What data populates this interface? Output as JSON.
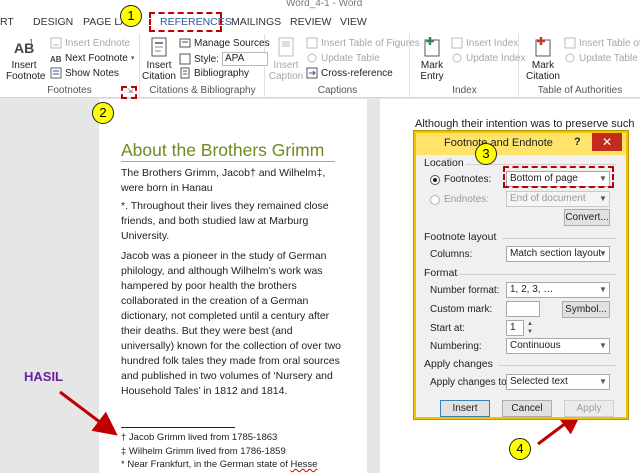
{
  "window": {
    "title": "Word_4-1 - Word"
  },
  "tabs": [
    "RT",
    "DESIGN",
    "PAGE LA",
    "REFERENCES",
    "MAILINGS",
    "REVIEW",
    "VIEW"
  ],
  "ribbon": {
    "footnotes": {
      "label": "Footnotes",
      "insert_footnote": "Insert Footnote",
      "insert_endnote": "Insert Endnote",
      "next_footnote": "Next Footnote",
      "show_notes": "Show Notes"
    },
    "citations": {
      "label": "Citations & Bibliography",
      "insert_citation": "Insert Citation",
      "manage_sources": "Manage Sources",
      "style_label": "Style:",
      "style_value": "APA",
      "bibliography": "Bibliography"
    },
    "captions": {
      "label": "Captions",
      "insert_caption": "Insert Caption",
      "insert_table_of_figures": "Insert Table of Figures",
      "update_table": "Update Table",
      "cross_reference": "Cross-reference"
    },
    "index": {
      "label": "Index",
      "mark_entry": "Mark Entry",
      "insert_index": "Insert Index",
      "update_index": "Update Index"
    },
    "authorities": {
      "label": "Table of Authorities",
      "mark_citation": "Mark Citation",
      "insert_table_of_authorities": "Insert Table of A",
      "update_table": "Update Table"
    }
  },
  "document": {
    "title": "About the Brothers Grimm",
    "p1": "The Brothers Grimm, Jacob† and Wilhelm‡, were born in Hanau",
    "p2": "*. Throughout their lives they remained close friends, and both studied law at Marburg University.",
    "p3": "Jacob was a pioneer in the study of German philology, and although Wilhelm’s work was hampered by poor health the brothers collaborated in the creation of a German dictionary, not completed until a century after their deaths. But they were best (and universally) known for the collection of over two hundred folk tales they made from oral sources and published in two volumes of ‘Nursery and Household Tales’ in 1812 and 1814.",
    "footnotes": [
      {
        "mark": "†",
        "text": " Jacob Grimm lived from 1785-1863"
      },
      {
        "mark": "‡",
        "text": " Wilhelm Grimm lived from 1786-1859"
      },
      {
        "mark": "*",
        "text": " Near Frankfurt, in the German state of ",
        "flagged": "Hesse"
      }
    ],
    "page2_text": "Although their intention was to preserve such"
  },
  "annotations": {
    "hasil": "HASIL",
    "badges": [
      "1",
      "2",
      "3",
      "4"
    ]
  },
  "dialog": {
    "title": "Footnote and Endnote",
    "help": "?",
    "close": "✕",
    "location": {
      "heading": "Location",
      "footnotes_label": "Footnotes:",
      "footnotes_value": "Bottom of page",
      "endnotes_label": "Endnotes:",
      "endnotes_value": "End of document",
      "convert": "Convert..."
    },
    "layout": {
      "heading": "Footnote layout",
      "columns_label": "Columns:",
      "columns_value": "Match section layout"
    },
    "format": {
      "heading": "Format",
      "number_format_label": "Number format:",
      "number_format_value": "1, 2, 3, …",
      "custom_mark_label": "Custom mark:",
      "custom_mark_value": "",
      "symbol": "Symbol...",
      "start_at_label": "Start at:",
      "start_at_value": "1",
      "numbering_label": "Numbering:",
      "numbering_value": "Continuous"
    },
    "apply": {
      "heading": "Apply changes",
      "apply_to_label": "Apply changes to:",
      "apply_to_value": "Selected text"
    },
    "buttons": {
      "insert": "Insert",
      "cancel": "Cancel",
      "apply": "Apply"
    }
  },
  "colors": {
    "accent": "#2b579a",
    "heading_green": "#6e8b1e",
    "annotation_red": "#c00000",
    "badge_yellow": "#ffff00",
    "hasil_purple": "#6b1fa0"
  }
}
